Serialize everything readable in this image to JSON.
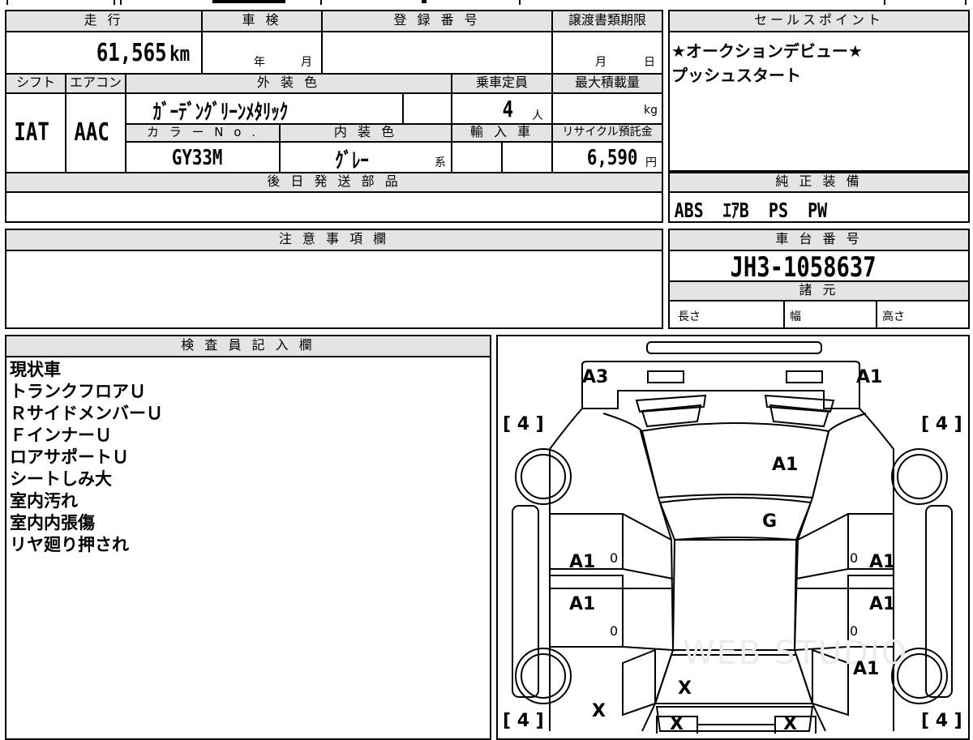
{
  "headers": {
    "mileage": "走 行",
    "inspection": "車 検",
    "registration": "登 録 番 号",
    "transfer_deadline": "譲渡書類期限",
    "sales_point": "セールスポイント",
    "shift": "シフト",
    "aircon": "エアコン",
    "exterior_color": "外 装 色",
    "capacity": "乗車定員",
    "max_load": "最大積載量",
    "color_no": "カ ラ ー N o .",
    "interior_color": "内 装 色",
    "import": "輸 入 車",
    "recycle": "リサイクル預託金",
    "later_parts": "後 日 発 送 部 品",
    "genuine_equipment": "純 正 装 備",
    "notes": "注 意 事 項 欄",
    "chassis_number": "車 台 番 号",
    "specs": "諸 元",
    "inspector": "検 査 員 記 入 欄"
  },
  "vehicle": {
    "mileage_value": "61,565",
    "mileage_unit": "km",
    "inspection_year": "年",
    "inspection_month": "月",
    "transfer_month": "月",
    "transfer_day": "日",
    "shift": "IAT",
    "aircon": "AAC",
    "exterior_color": "ｶﾞｰﾃﾞﾝｸﾞﾘｰﾝﾒﾀﾘｯｸ",
    "capacity_value": "4",
    "capacity_unit": "人",
    "max_load_unit": "kg",
    "color_no": "GY33M",
    "interior_color": "ｸﾞﾚｰ",
    "interior_suffix": "系",
    "recycle_value": "6,590",
    "recycle_unit": "円",
    "chassis_number": "JH3-1058637",
    "spec_length": "長さ",
    "spec_width": "幅",
    "spec_height": "高さ"
  },
  "sales_points": [
    "★オークションデビュー★",
    "プッシュスタート"
  ],
  "equipment": "ABS  ｴｱB  PS  PW",
  "inspector_notes": [
    "現状車",
    "トランクフロアＵ",
    "ＲサイドメンバーＵ",
    "ＦインナーＵ",
    "ロアサポートＵ",
    "シートしみ大",
    "室内汚れ",
    "室内内張傷",
    "リヤ廻り押され"
  ],
  "diagram": {
    "tire_bracket": "[ 4 ]",
    "marks": {
      "front_left_corner": "A3",
      "front_right_corner": "A1",
      "hood": "A1",
      "windshield": "G",
      "left_front_door": "A1",
      "right_front_door": "A1",
      "left_rear_door": "A1",
      "right_rear_door": "A1",
      "right_rear_quarter": "A1",
      "rear_glass": "X",
      "left_rear_quarter": "X",
      "rear_left_lamp": "X",
      "rear_right_lamp": "X"
    },
    "door_markers": [
      "0",
      "0",
      "0",
      "0"
    ],
    "watermark": "WEB STUDIO"
  }
}
